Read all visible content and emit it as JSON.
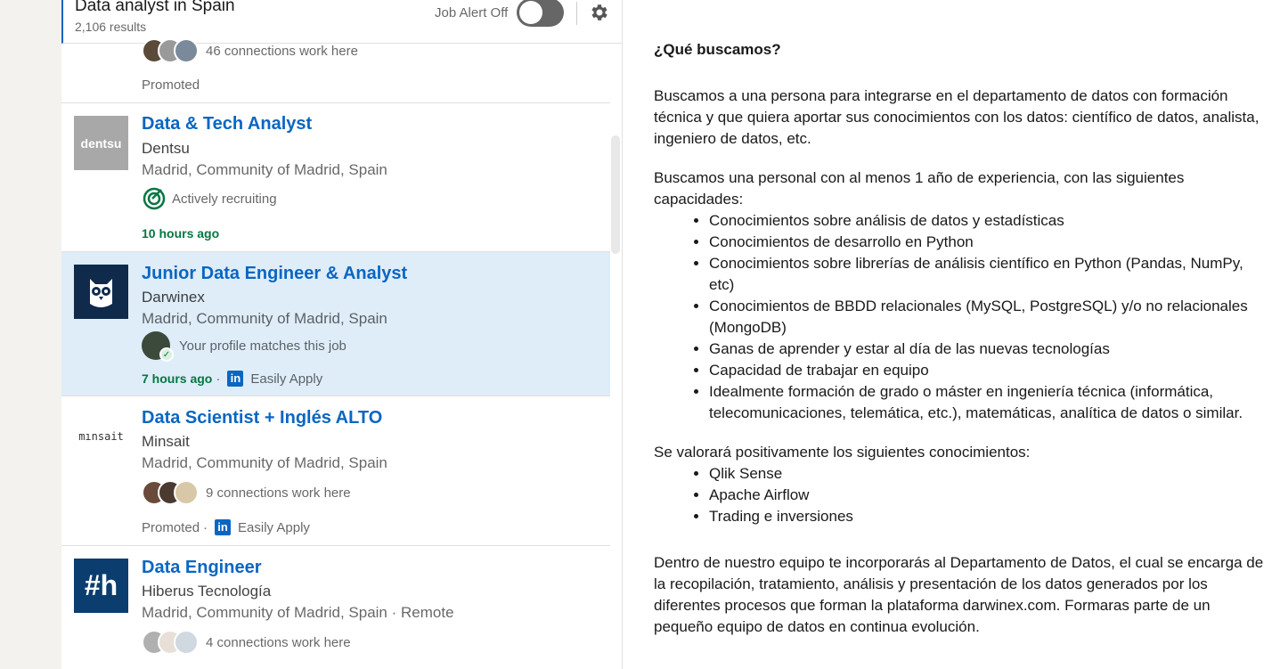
{
  "search": {
    "title": "Data analyst in Spain",
    "results": "2,106 results",
    "job_alert_label": "Job Alert Off"
  },
  "jobs": [
    {
      "partial": true,
      "insight": "46 connections work here",
      "footer": "Promoted"
    },
    {
      "title": "Data & Tech Analyst",
      "company": "Dentsu",
      "location": "Madrid, Community of Madrid, Spain",
      "insight": "Actively recruiting",
      "time": "10 hours ago",
      "logo_text": "dentsu",
      "logo_color": "#a8a8a8"
    },
    {
      "title": "Junior Data Engineer & Analyst",
      "company": "Darwinex",
      "location": "Madrid, Community of Madrid, Spain",
      "insight": "Your profile matches this job",
      "time": "7 hours ago",
      "apply": "Easily Apply",
      "logo_color": "#0f2a4a",
      "selected": true
    },
    {
      "title": "Data Scientist + Inglés ALTO",
      "company": "Minsait",
      "location": "Madrid, Community of Madrid, Spain",
      "insight": "9 connections work here",
      "footer": "Promoted",
      "apply": "Easily Apply",
      "logo_text": "mınsait"
    },
    {
      "title": "Data Engineer",
      "company": "Hiberus Tecnología",
      "location": "Madrid, Community of Madrid, Spain · Remote",
      "insight": "4 connections work here",
      "logo_text": "#h",
      "logo_color": "#0b3d6e"
    }
  ],
  "description": {
    "heading": "¿Qué buscamos?",
    "para1": "Buscamos a una persona para integrarse en el departamento de datos con formación técnica y que quiera aportar sus conocimientos con los datos: científico de datos, analista, ingeniero de datos, etc.",
    "para2": "Buscamos una personal con al menos 1 año de experiencia, con las siguientes capacidades:",
    "list1": [
      "Conocimientos sobre análisis de datos y estadísticas",
      "Conocimientos de desarrollo en Python",
      "Conocimientos sobre librerías de análisis científico en Python (Pandas, NumPy, etc)",
      "Conocimientos de BBDD relacionales (MySQL, PostgreSQL) y/o no relacionales (MongoDB)",
      "Ganas de aprender y estar al día de las nuevas tecnologías",
      "Capacidad de trabajar en equipo",
      "Idealmente formación de grado o máster en ingeniería técnica (informática, telecomunicaciones, telemática, etc.), matemáticas, analítica de datos o similar."
    ],
    "para3": "Se valorará positivamente los siguientes conocimientos:",
    "list2": [
      "Qlik Sense",
      "Apache Airflow",
      "Trading e inversiones"
    ],
    "para4": "Dentro de nuestro equipo te incorporarás al Departamento de Datos, el cual se encarga de la recopilación, tratamiento, análisis y presentación de los datos generados por los diferentes procesos que forman la plataforma darwinex.com. Formaras parte de un pequeño equipo de datos en continua evolución."
  },
  "colors": {
    "link_blue": "#0a66c2",
    "time_green": "#057642",
    "selected_bg": "#dfedf9"
  }
}
